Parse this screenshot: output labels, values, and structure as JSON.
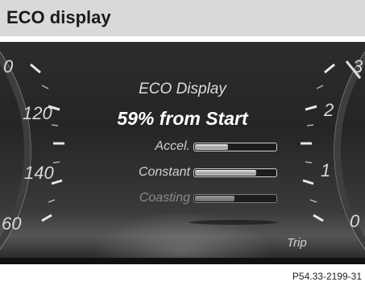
{
  "header": {
    "title": "ECO display"
  },
  "left_gauge": {
    "numbers": [
      "0",
      "120",
      "140",
      "60"
    ]
  },
  "right_gauge": {
    "numbers": [
      "3",
      "2",
      "1",
      "0"
    ]
  },
  "eco": {
    "title": "ECO Display",
    "summary": "59% from Start",
    "rows": [
      {
        "label": "Accel.",
        "level": 0.42
      },
      {
        "label": "Constant",
        "level": 0.76
      },
      {
        "label": "Coasting",
        "level": 0.5
      }
    ]
  },
  "footer": {
    "trip_label": "Trip"
  },
  "caption": "P54.33-2199-31",
  "colors": {
    "header_bg": "#d9d9d9",
    "panel_bg": "#2c2c2c",
    "text": "#dcdcdc"
  }
}
